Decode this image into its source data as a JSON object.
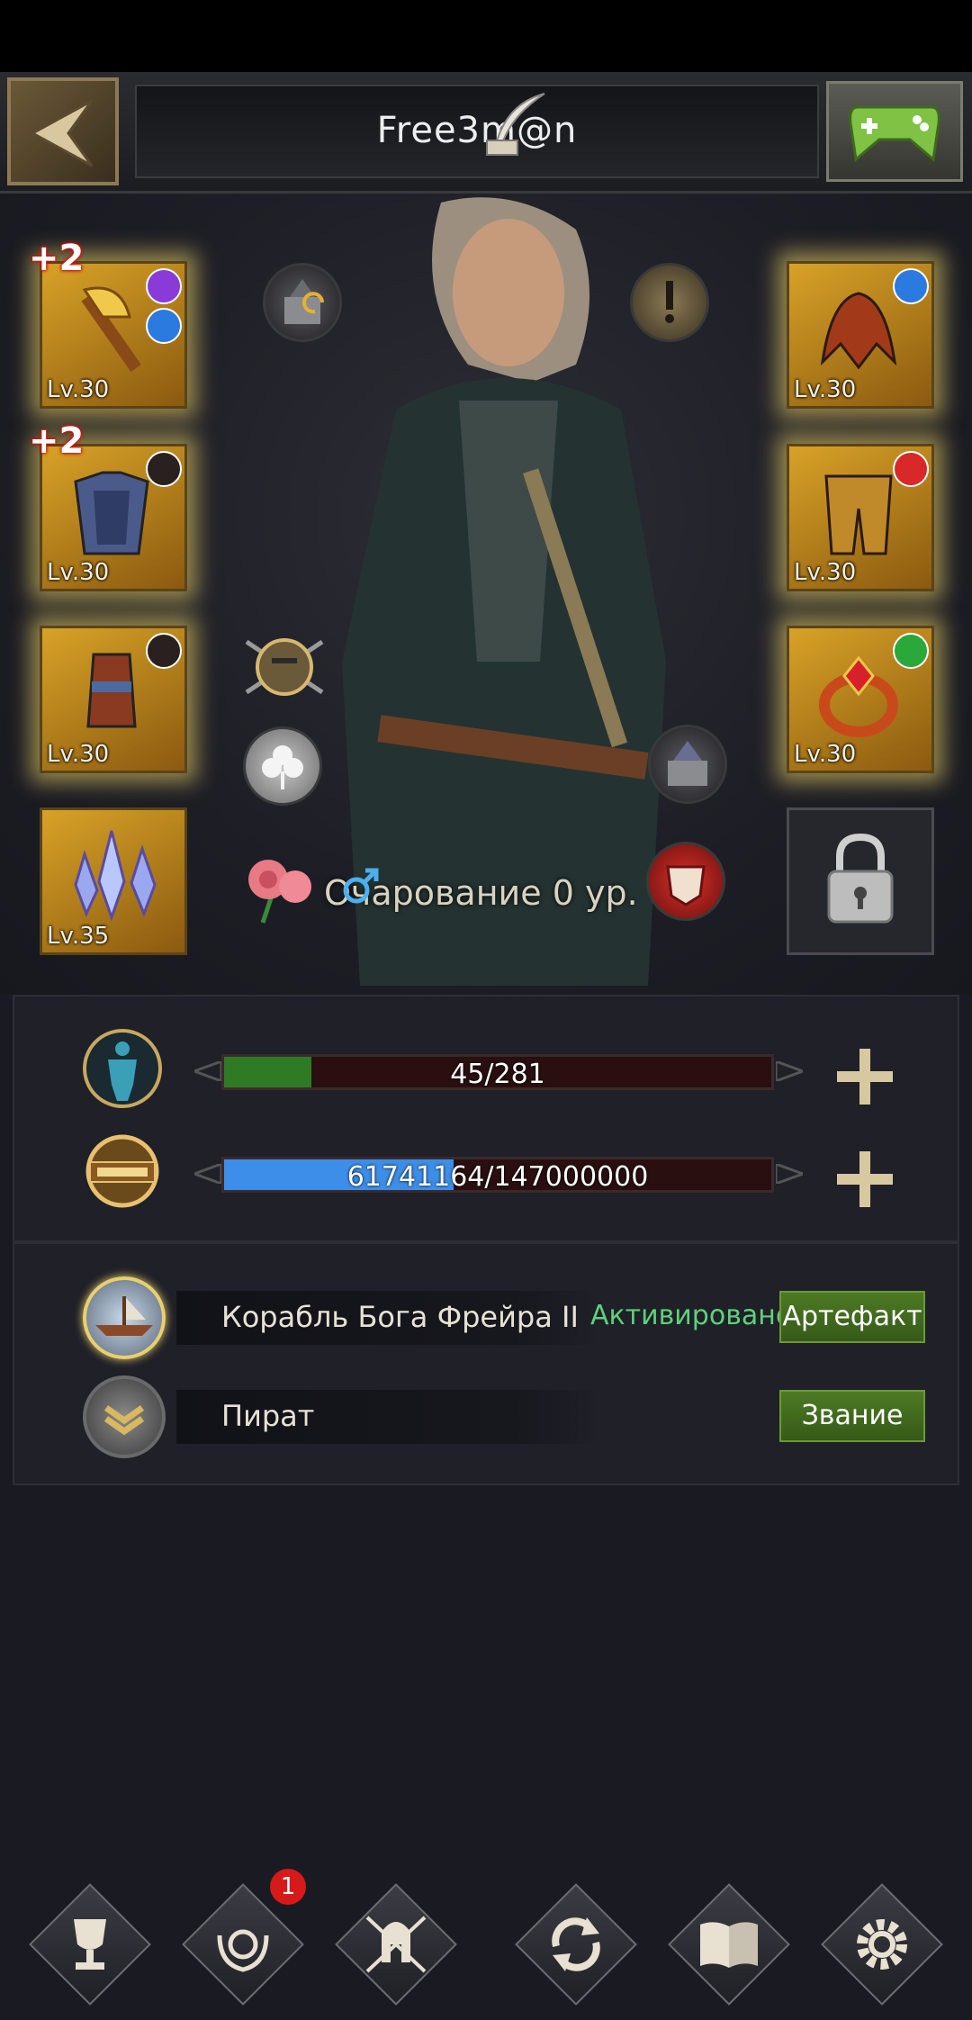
{
  "header": {
    "player_name": "Free3m@n"
  },
  "equipment": {
    "left": [
      {
        "level": "Lv.30",
        "bonus": "+2",
        "icon": "golden-axe-icon"
      },
      {
        "level": "Lv.30",
        "bonus": "+2",
        "icon": "armor-icon"
      },
      {
        "level": "Lv.30",
        "bonus": "",
        "icon": "gauntlet-icon"
      },
      {
        "level": "Lv.35",
        "bonus": "",
        "icon": "crystal-icon"
      }
    ],
    "right": [
      {
        "level": "Lv.30",
        "icon": "helmet-icon"
      },
      {
        "level": "Lv.30",
        "icon": "leg-armor-icon"
      },
      {
        "level": "Lv.30",
        "icon": "ring-icon"
      }
    ]
  },
  "charm": {
    "text": "Очарование 0 ур."
  },
  "stats": {
    "stamina": {
      "value": "45/281",
      "fill_fraction": 0.16
    },
    "exp": {
      "value": "61741164/147000000",
      "fill_fraction": 0.42
    }
  },
  "titles": {
    "artifact": {
      "name": "Корабль Бога Фрейра II",
      "status": "Активировано",
      "button": "Артефакт"
    },
    "rank": {
      "name": "Пират",
      "button": "Звание"
    }
  },
  "nav": {
    "badge_count": "1"
  },
  "colors": {
    "stamina_bar": "#2f7a25",
    "exp_bar": "#3d8ee8",
    "status_active": "#5fd17a"
  }
}
